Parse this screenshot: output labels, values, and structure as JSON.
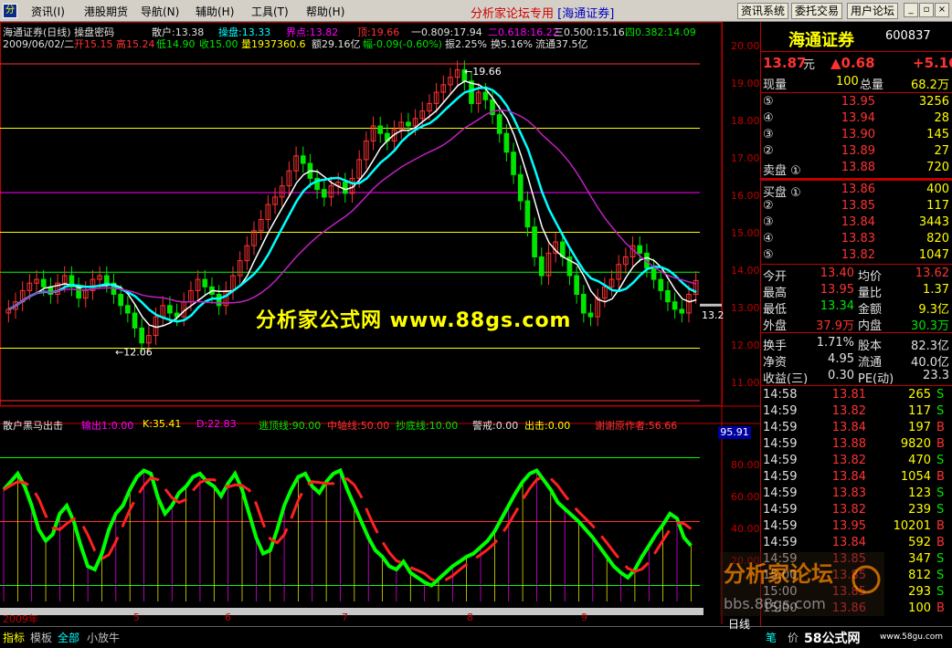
{
  "menubar": {
    "items": [
      "资讯(I)",
      "港股期货",
      "导航(N)",
      "辅助(H)",
      "工具(T)",
      "帮助(H)"
    ],
    "title_prefix": "分析家论坛专用",
    "title_broker": "[海通证券]",
    "buttons": [
      "资讯系统",
      "委托交易",
      "用户论坛"
    ]
  },
  "kline_header": {
    "line1_left": "海通证券(日线) 操盘密码",
    "sanhu": "散户:13.38",
    "caopan": "操盘:13.33",
    "jiedian": "界点:13.82",
    "ding": "顶:19.66",
    "fib1": "一0.809:17.94",
    "fib2": "二0.618:16.22",
    "fib3": "三0.500:15.16",
    "fib4": "四0.382:14.09",
    "line2_date": "2009/06/02/二",
    "kai": "开15.15",
    "gao": "高15.24",
    "di": "低14.90",
    "shou": "收15.00",
    "liang": "量1937360.6",
    "e": "额29.16亿",
    "fu": "幅-0.09(-0.60%)",
    "zhen": "振2.25%",
    "huan": "换5.16%",
    "liutong": "流通37.5亿"
  },
  "main_chart": {
    "price_axis": [
      "20.00",
      "19.00",
      "18.00",
      "17.00",
      "16.00",
      "15.00",
      "14.00",
      "13.00",
      "12.00",
      "11.00"
    ],
    "high_label": "19.66",
    "low_label": "12.06",
    "right_price_label": "13.2"
  },
  "sub_header": {
    "name": "散户黑马出击",
    "shuchu": "输出1:0.00",
    "k": "K:35.41",
    "d": "D:22.83",
    "taoding": "逃顶线:90.00",
    "zhongzhou": "中轴线:50.00",
    "chaodi": "抄底线:10.00",
    "jingjie": "警戒:0.00",
    "chuji": "出击:0.00",
    "author": "谢谢原作者:56.66",
    "current": "95.91"
  },
  "sub_axis": [
    "80.00",
    "60.00",
    "40.00",
    "20.00"
  ],
  "date_axis": [
    "2009年",
    "5",
    "6",
    "7",
    "8",
    "9"
  ],
  "watermark": "分析家公式网 www.88gs.com",
  "quote": {
    "title": "海通证券",
    "code": "600837",
    "price": "13.87",
    "unit": "元",
    "change": "▲0.68",
    "change_pct": "+5.16",
    "xianliang_label": "现量",
    "xianliang": "100",
    "zongliang_label": "总量",
    "zongliang": "68.2万",
    "sell": [
      {
        "label": "⑤",
        "price": "13.95",
        "vol": "3256"
      },
      {
        "label": "④",
        "price": "13.94",
        "vol": "28"
      },
      {
        "label": "③",
        "price": "13.90",
        "vol": "145"
      },
      {
        "label": "②",
        "price": "13.89",
        "vol": "27"
      },
      {
        "label": "卖盘 ①",
        "price": "13.88",
        "vol": "720"
      }
    ],
    "buy": [
      {
        "label": "买盘 ①",
        "price": "13.86",
        "vol": "400"
      },
      {
        "label": "②",
        "price": "13.85",
        "vol": "117"
      },
      {
        "label": "③",
        "price": "13.84",
        "vol": "3443"
      },
      {
        "label": "④",
        "price": "13.83",
        "vol": "820"
      },
      {
        "label": "⑤",
        "price": "13.82",
        "vol": "1047"
      }
    ],
    "stats": [
      {
        "l1": "今开",
        "v1": "13.40",
        "l2": "均价",
        "v2": "13.62"
      },
      {
        "l1": "最高",
        "v1": "13.95",
        "l2": "量比",
        "v2": "1.37"
      },
      {
        "l1": "最低",
        "v1": "13.34",
        "l2": "金额",
        "v2": "9.3亿"
      },
      {
        "l1": "外盘",
        "v1": "37.9万",
        "l2": "内盘",
        "v2": "30.3万"
      }
    ],
    "stats2": [
      {
        "l1": "换手",
        "v1": "1.71%",
        "l2": "股本",
        "v2": "82.3亿"
      },
      {
        "l1": "净资",
        "v1": "4.95",
        "l2": "流通",
        "v2": "40.0亿"
      },
      {
        "l1": "收益(三)",
        "v1": "0.30",
        "l2": "PE(动)",
        "v2": "23.3"
      }
    ],
    "ticks": [
      {
        "t": "14:58",
        "p": "13.81",
        "v": "265",
        "s": "S"
      },
      {
        "t": "14:59",
        "p": "13.82",
        "v": "117",
        "s": "S"
      },
      {
        "t": "14:59",
        "p": "13.84",
        "v": "197",
        "s": "B"
      },
      {
        "t": "14:59",
        "p": "13.88",
        "v": "9820",
        "s": "B"
      },
      {
        "t": "14:59",
        "p": "13.82",
        "v": "470",
        "s": "S"
      },
      {
        "t": "14:59",
        "p": "13.84",
        "v": "1054",
        "s": "B"
      },
      {
        "t": "14:59",
        "p": "13.83",
        "v": "123",
        "s": "S"
      },
      {
        "t": "14:59",
        "p": "13.82",
        "v": "239",
        "s": "S"
      },
      {
        "t": "14:59",
        "p": "13.95",
        "v": "10201",
        "s": "B"
      },
      {
        "t": "14:59",
        "p": "13.84",
        "v": "592",
        "s": "B"
      },
      {
        "t": "14:59",
        "p": "13.85",
        "v": "347",
        "s": "S"
      },
      {
        "t": "15:00",
        "p": "13.85",
        "v": "812",
        "s": "S"
      },
      {
        "t": "15:00",
        "p": "13.85",
        "v": "293",
        "s": "S"
      },
      {
        "t": "15:00",
        "p": "13.86",
        "v": "100",
        "s": "B"
      }
    ]
  },
  "bottom": {
    "tabs": [
      "指标",
      "模板",
      "全部",
      "小放牛"
    ],
    "period": "日线",
    "right_tabs": [
      "笔",
      "价"
    ],
    "site": "58公式网",
    "site_url": "www.58gu.com",
    "watermark2": "分析家论坛",
    "watermark2_url": "bbs.88gs.com"
  }
}
